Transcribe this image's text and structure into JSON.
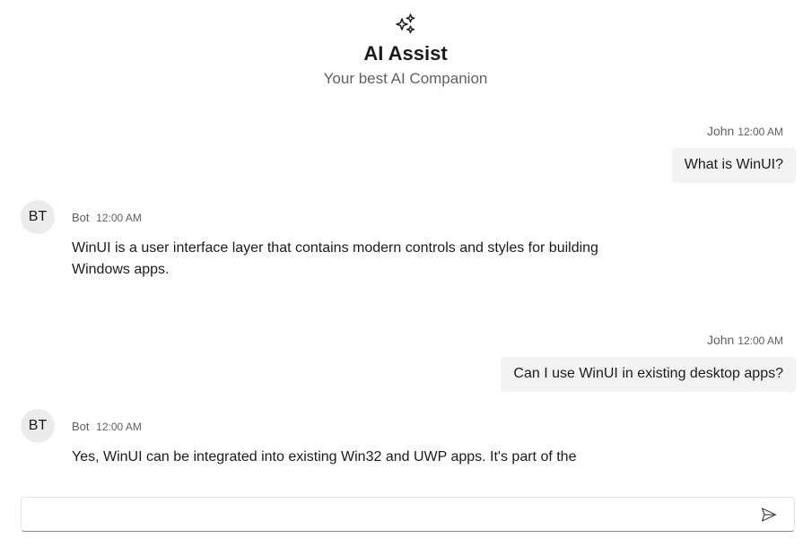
{
  "header": {
    "icon": "sparkle-icon",
    "title": "AI Assist",
    "subtitle": "Your best AI Companion"
  },
  "messages": [
    {
      "direction": "out",
      "author": "John",
      "time": "12:00 AM",
      "text": "What is WinUI?"
    },
    {
      "direction": "in",
      "avatar": "BT",
      "author": "Bot",
      "time": "12:00 AM",
      "text": "WinUI is a user interface layer that contains modern controls and styles for building Windows apps."
    },
    {
      "direction": "out",
      "author": "John",
      "time": "12:00 AM",
      "text": "Can I use WinUI in existing desktop apps?"
    },
    {
      "direction": "in",
      "avatar": "BT",
      "author": "Bot",
      "time": "12:00 AM",
      "text": "Yes, WinUI can be integrated into existing Win32 and UWP apps. It's part of the"
    }
  ],
  "input": {
    "value": "",
    "placeholder": "",
    "send_icon": "send-icon"
  }
}
